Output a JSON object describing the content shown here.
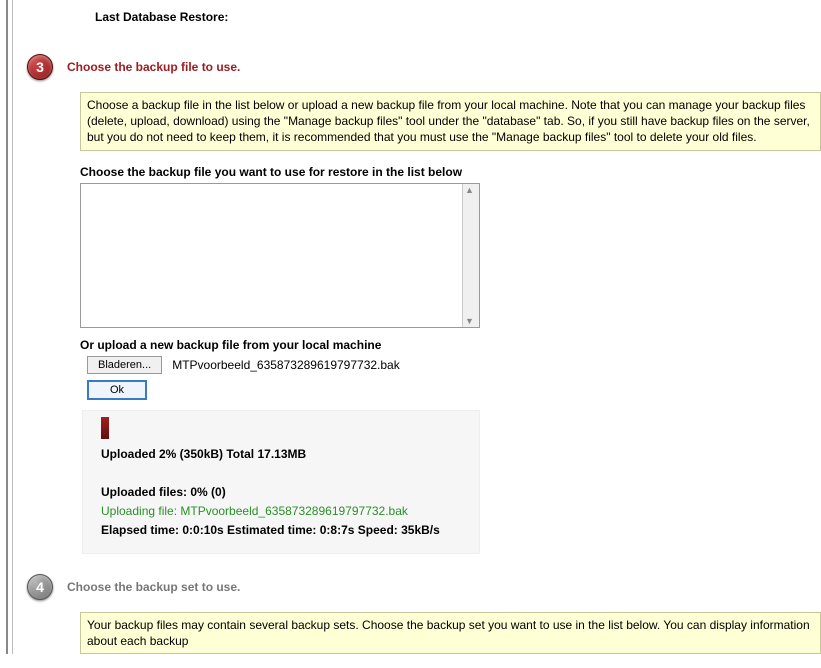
{
  "top": {
    "last_restore_label": "Last Database Restore:"
  },
  "step3": {
    "number": "3",
    "title": "Choose the backup file to use.",
    "info": "Choose a backup file in the list below or upload a new backup file from your local machine. Note that you can manage your backup files (delete, upload, download) using the \"Manage backup files\" tool under the \"database\" tab. So, if you still have backup files on the server, but you do not need to keep them, it is recommended that you must use the \"Manage backup files\" tool to delete your old files.",
    "list_label": "Choose the backup file you want to use for restore in the list below",
    "upload_label": "Or upload a new backup file from your local machine",
    "browse_btn": "Bladeren...",
    "filename": "MTPvoorbeeld_635873289619797732.bak",
    "ok_btn": "Ok",
    "progress": {
      "summary": "Uploaded 2% (350kB) Total 17.13MB",
      "files_line": "Uploaded files: 0% (0)",
      "uploading_line": "Uploading file: MTPvoorbeeld_635873289619797732.bak",
      "timing_line": "Elapsed time: 0:0:10s Estimated time: 0:8:7s Speed: 35kB/s"
    }
  },
  "step4": {
    "number": "4",
    "title": "Choose the backup set to use.",
    "info": "Your backup files may contain several backup sets. Choose the backup set you want to use in the list below. You can display information about each backup "
  }
}
